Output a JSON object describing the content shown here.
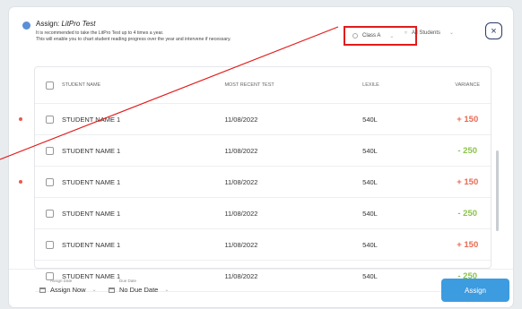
{
  "header": {
    "title_prefix": "Assign: ",
    "title_name": "LitPro Test",
    "desc_line1": "It is recommended to take the LitPro Test up to 4 times a year.",
    "desc_line2": "This will enable you to chart student reading progress over the year and intervene if necessary."
  },
  "filters": {
    "class": "Class A",
    "students": "All Students"
  },
  "close": "×",
  "table": {
    "headers": [
      "STUDENT NAME",
      "MOST RECENT TEST",
      "LEXILE",
      "VARIANCE"
    ],
    "rows": [
      {
        "name": "STUDENT NAME 1",
        "test": "11/08/2022",
        "lexile": "540L",
        "variance": "+ 150",
        "flag": true
      },
      {
        "name": "STUDENT NAME 1",
        "test": "11/08/2022",
        "lexile": "540L",
        "variance": "- 250",
        "flag": false
      },
      {
        "name": "STUDENT NAME 1",
        "test": "11/08/2022",
        "lexile": "540L",
        "variance": "+ 150",
        "flag": true
      },
      {
        "name": "STUDENT NAME 1",
        "test": "11/08/2022",
        "lexile": "540L",
        "variance": "- 250",
        "flag": false
      },
      {
        "name": "STUDENT NAME 1",
        "test": "11/08/2022",
        "lexile": "540L",
        "variance": "+ 150",
        "flag": false
      },
      {
        "name": "STUDENT NAME 1",
        "test": "11/08/2022",
        "lexile": "540L",
        "variance": "- 250",
        "flag": false
      }
    ]
  },
  "footer": {
    "assign_date_label": "Assign Date",
    "assign_date_value": "Assign Now",
    "due_date_label": "Due Date",
    "due_date_value": "No Due Date",
    "assign_button": "Assign"
  },
  "colors": {
    "highlight": "#e21b1b",
    "positive_variance": "#e86a54",
    "negative_variance": "#8bc34a",
    "primary": "#3d9be0"
  }
}
